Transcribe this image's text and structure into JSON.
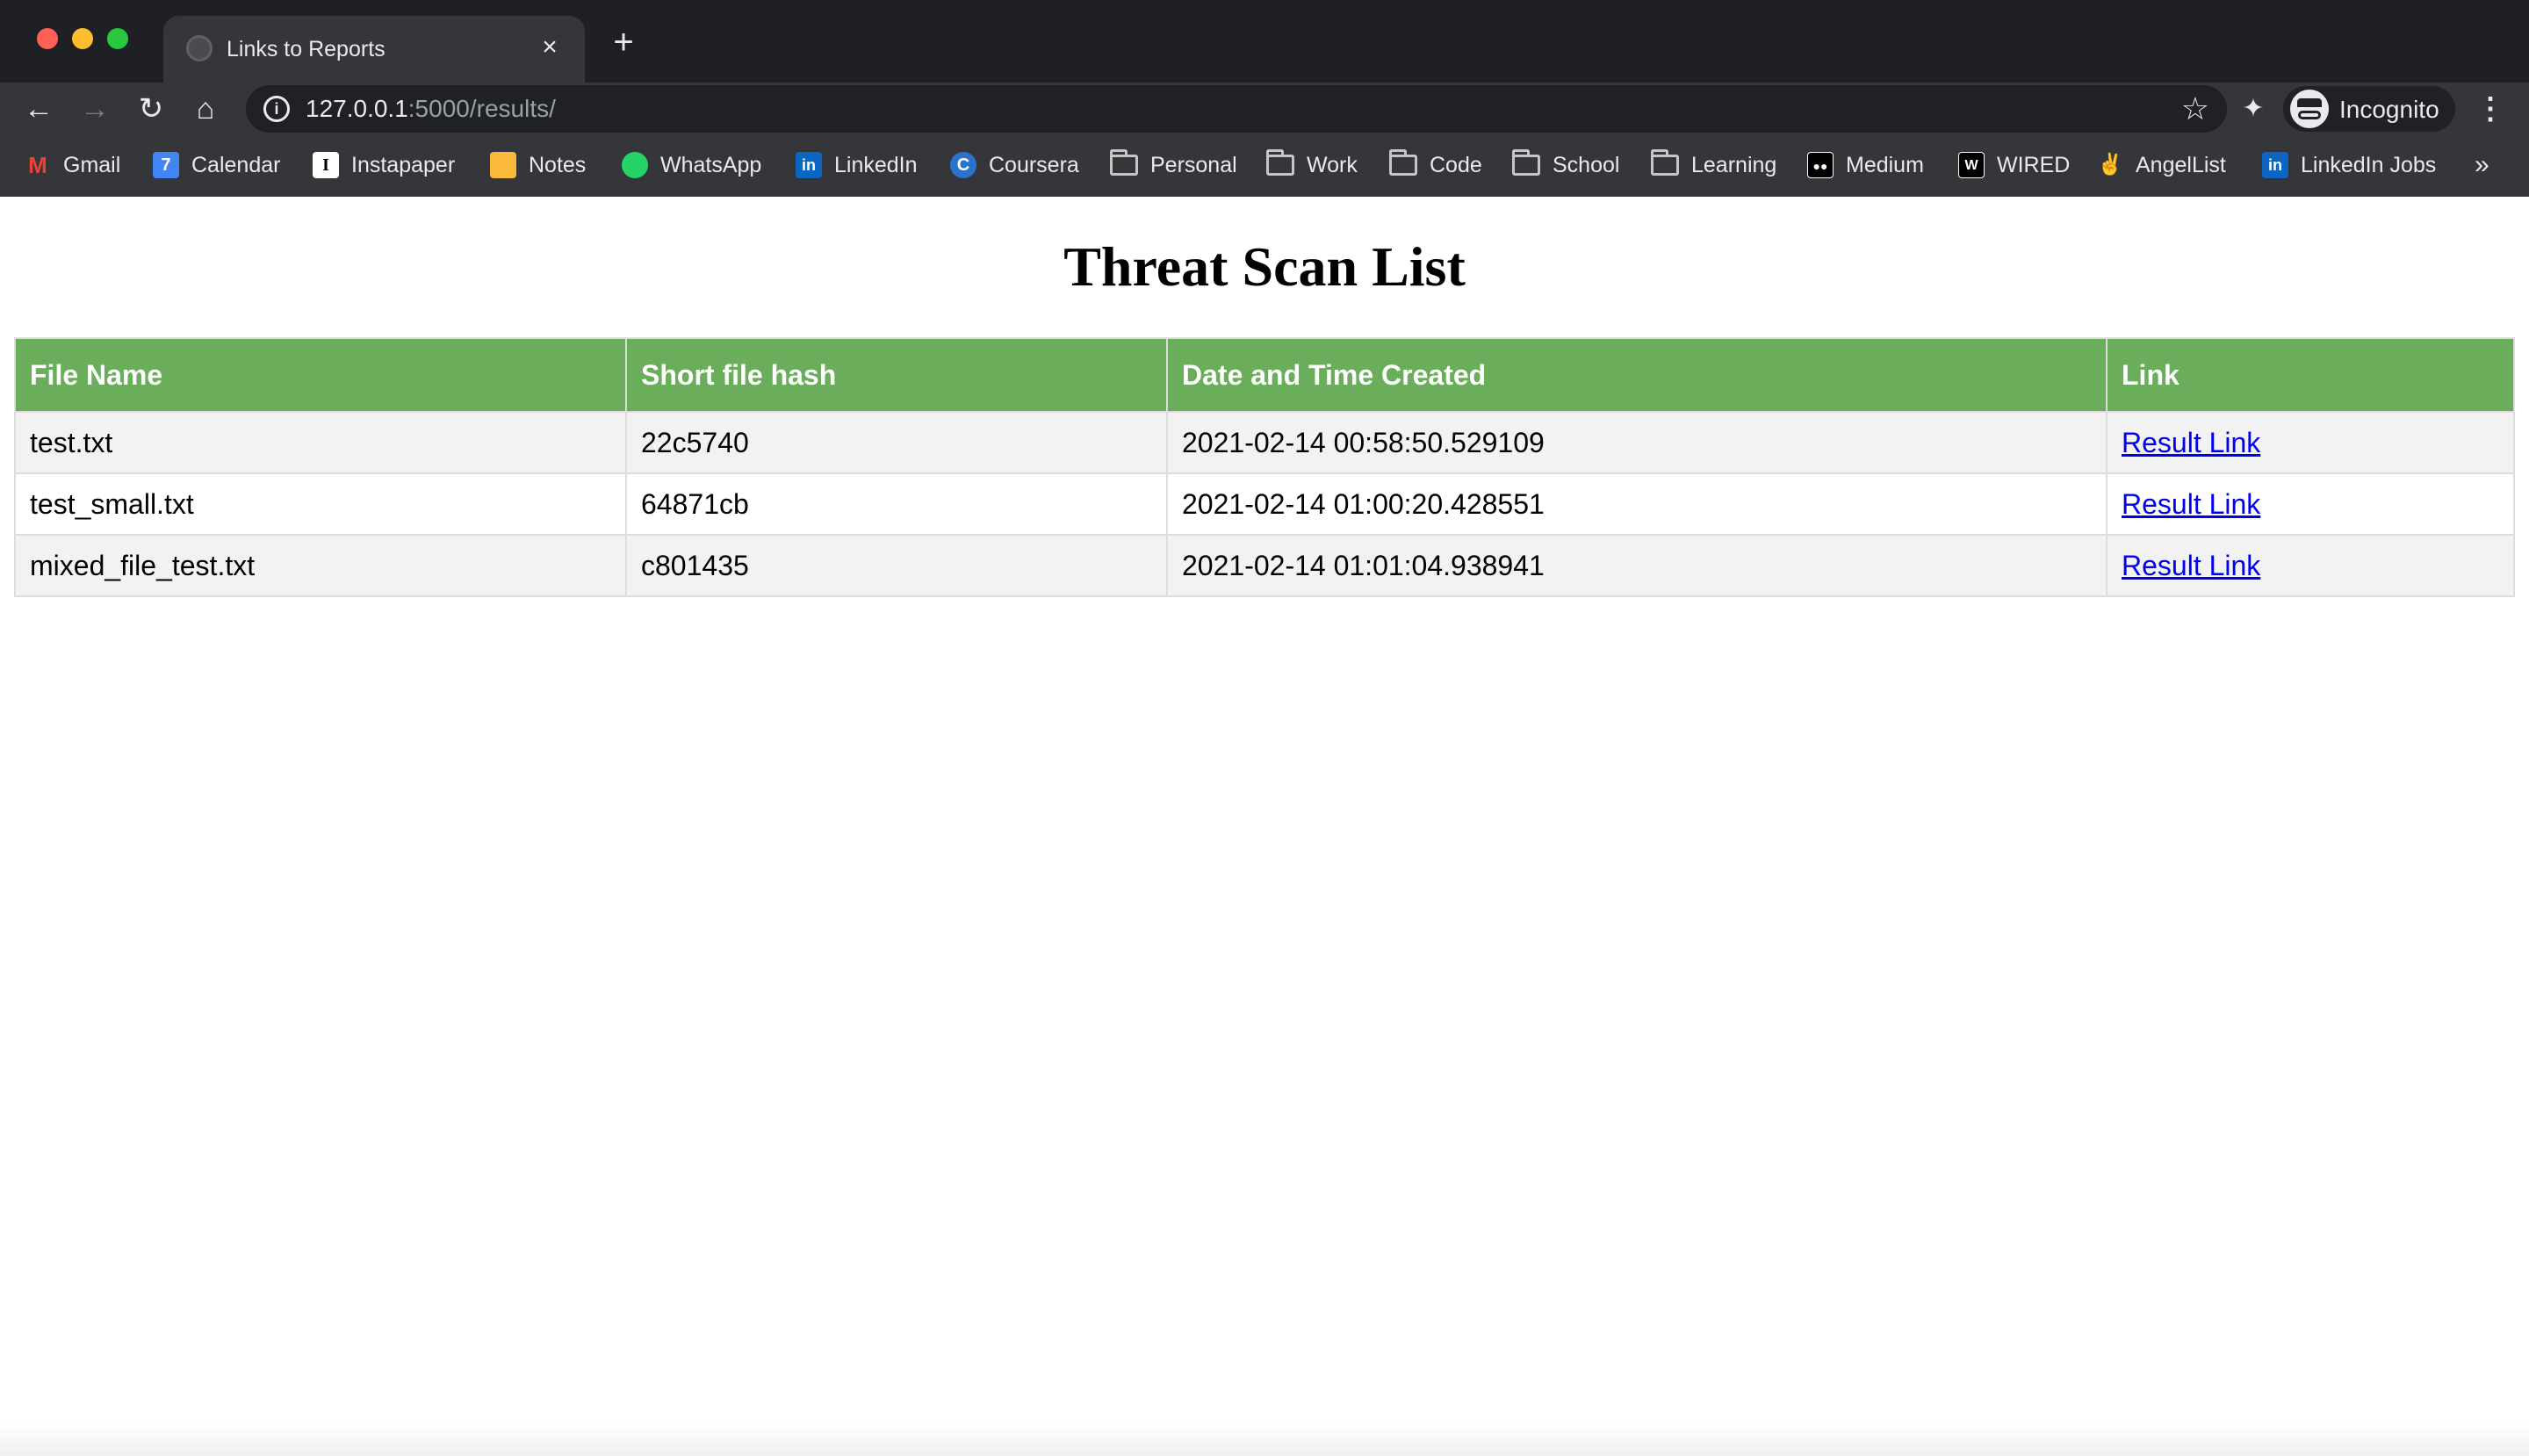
{
  "browser": {
    "tab_title": "Links to Reports",
    "tab_close": "×",
    "new_tab": "+",
    "url_host": "127.0.0.1",
    "url_path": ":5000/results/",
    "profile_label": "Incognito",
    "bookmarks": [
      {
        "label": "Gmail",
        "icon": "gmail-icon",
        "color": "#ea4335"
      },
      {
        "label": "Calendar",
        "icon": "calendar-icon",
        "color": "#4285f4",
        "glyph": "7"
      },
      {
        "label": "Instapaper",
        "icon": "instapaper-icon",
        "color": "#ffffff",
        "glyph": "I"
      },
      {
        "label": "Notes",
        "icon": "notes-icon",
        "color": "#f9ba3c"
      },
      {
        "label": "WhatsApp",
        "icon": "whatsapp-icon",
        "color": "#25d366"
      },
      {
        "label": "LinkedIn",
        "icon": "linkedin-icon",
        "color": "#0a66c2",
        "glyph": "in"
      },
      {
        "label": "Coursera",
        "icon": "coursera-icon",
        "color": "#2a73cc",
        "glyph": "C"
      },
      {
        "label": "Personal",
        "icon": "folder-icon"
      },
      {
        "label": "Work",
        "icon": "folder-icon"
      },
      {
        "label": "Code",
        "icon": "folder-icon"
      },
      {
        "label": "School",
        "icon": "folder-icon"
      },
      {
        "label": "Learning",
        "icon": "folder-icon"
      },
      {
        "label": "Medium",
        "icon": "medium-icon",
        "color": "#000000",
        "glyph": "●●"
      },
      {
        "label": "WIRED",
        "icon": "wired-icon",
        "color": "#000000",
        "glyph": "W"
      },
      {
        "label": "AngelList",
        "icon": "angellist-icon",
        "color": "#ffffff",
        "glyph": "✌"
      },
      {
        "label": "LinkedIn Jobs",
        "icon": "linkedin-icon",
        "color": "#0a66c2",
        "glyph": "in"
      }
    ],
    "bookmarks_overflow": "»"
  },
  "page": {
    "heading": "Threat Scan List",
    "columns": [
      "File Name",
      "Short file hash",
      "Date and Time Created",
      "Link"
    ],
    "rows": [
      {
        "file_name": "test.txt",
        "hash": "22c5740",
        "created": "2021-02-14 00:58:50.529109",
        "link_label": "Result Link"
      },
      {
        "file_name": "test_small.txt",
        "hash": "64871cb",
        "created": "2021-02-14 01:00:20.428551",
        "link_label": "Result Link"
      },
      {
        "file_name": "mixed_file_test.txt",
        "hash": "c801435",
        "created": "2021-02-14 01:01:04.938941",
        "link_label": "Result Link"
      }
    ],
    "header_color": "#6aad5b"
  }
}
